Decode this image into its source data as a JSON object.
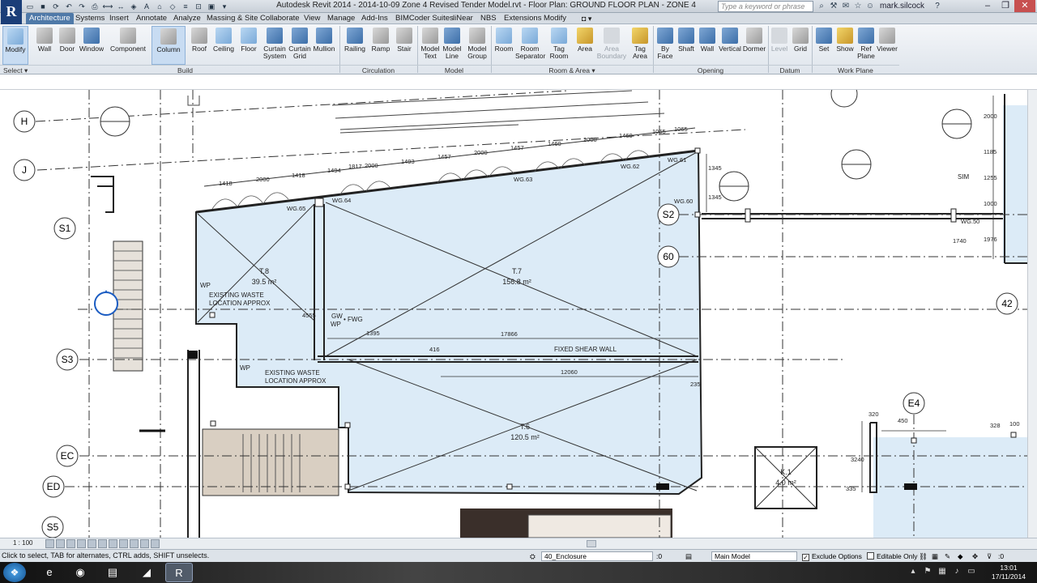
{
  "window": {
    "title": "Autodesk Revit 2014 -     2014-10-09 Zone 4 Revised Tender Model.rvt - Floor Plan: GROUND FLOOR PLAN - ZONE 4",
    "app_logo": "R",
    "search_placeholder": "Type a keyword or phrase",
    "user": "mark.silcock",
    "help": "?"
  },
  "ribbon_tabs": [
    "Architecture",
    "Systems",
    "Insert",
    "Annotate",
    "Analyze",
    "Massing & Site",
    "Collaborate",
    "View",
    "Manage",
    "Add-Ins",
    "BIMCoder Suites",
    "liNear",
    "NBS",
    "Extensions",
    "Modify"
  ],
  "ribbon_buttons": {
    "modify": "Modify",
    "wall": "Wall",
    "door": "Door",
    "window": "Window",
    "component": "Component",
    "column": "Column",
    "roof": "Roof",
    "ceiling": "Ceiling",
    "floor": "Floor",
    "curtain_system": "Curtain System",
    "curtain_grid": "Curtain Grid",
    "mullion": "Mullion",
    "railing": "Railing",
    "ramp": "Ramp",
    "stair": "Stair",
    "model_text": "Model Text",
    "model_line": "Model Line",
    "model_group": "Model Group",
    "room": "Room",
    "room_separator": "Room Separator",
    "tag_room": "Tag Room",
    "area": "Area",
    "area_boundary": "Area Boundary",
    "tag_area": "Tag Area",
    "by_face": "By Face",
    "shaft": "Shaft",
    "wall_opening": "Wall",
    "vertical": "Vertical",
    "dormer": "Dormer",
    "level": "Level",
    "grid": "Grid",
    "set": "Set",
    "show": "Show",
    "ref_plane": "Ref Plane",
    "viewer": "Viewer"
  },
  "panels": {
    "select": "Select ▾",
    "build": "Build",
    "circulation": "Circulation",
    "model": "Model",
    "room_area": "Room & Area ▾",
    "opening": "Opening",
    "datum": "Datum",
    "work_plane": "Work Plane"
  },
  "grid_bubbles": [
    "H",
    "J",
    "S1",
    "S3",
    "EC",
    "ED",
    "S5",
    "S2",
    "60",
    "42",
    "E4"
  ],
  "rooms": [
    {
      "tag": "T.8",
      "area": "39.5 m²"
    },
    {
      "tag": "T.7",
      "area": "156.8 m²"
    },
    {
      "tag": "T.6",
      "area": "120.5 m²"
    },
    {
      "tag": "K.1",
      "area": "4.0 m²"
    }
  ],
  "annotations": {
    "waste1": "EXISTING WASTE",
    "waste1b": "LOCATION APPROX",
    "waste2": "EXISTING WASTE",
    "waste2b": "LOCATION APPROX",
    "shear_wall": "FIXED SHEAR WALL",
    "sim": "SIM",
    "wp1": "WP",
    "wp2": "WP",
    "gw": "GW",
    "wp3": "WP",
    "fwg": "• FWG"
  },
  "window_tags": [
    "WG.65",
    "WG.64",
    "WG.63",
    "WG.62",
    "WG.61",
    "WG.60",
    "WG.50"
  ],
  "dimensions": {
    "top_row": [
      "1418",
      "2000",
      "1418",
      "1494",
      "1817",
      "2000",
      "1493",
      "1457",
      "2000",
      "1457",
      "1460",
      "2000",
      "1460",
      "1065",
      "1065"
    ],
    "d17866": "17866",
    "d12060": "12060",
    "d4555": "4555",
    "d1395": "1395",
    "d416": "416",
    "d235": "235",
    "right": [
      "1345",
      "1345",
      "2000",
      "1185",
      "1255",
      "1000",
      "1740",
      "1976"
    ],
    "lower_right": [
      "320",
      "450",
      "3240",
      "335",
      "328",
      "100"
    ]
  },
  "view_bar": {
    "scale": "1 : 100"
  },
  "status": {
    "hint": "Click to select, TAB for alternates, CTRL adds, SHIFT unselects.",
    "workset": "40_Enclosure",
    "selection_count": ":0",
    "design_option": "Main Model",
    "exclude_options": "Exclude Options",
    "editable_only": "Editable Only",
    "filter_count": ":0"
  },
  "taskbar": {
    "time": "13:01",
    "date": "17/11/2014"
  },
  "colors": {
    "room_fill": "#dcebf7",
    "accent": "#4f79a8",
    "stair_fill": "#d9cfc2"
  }
}
